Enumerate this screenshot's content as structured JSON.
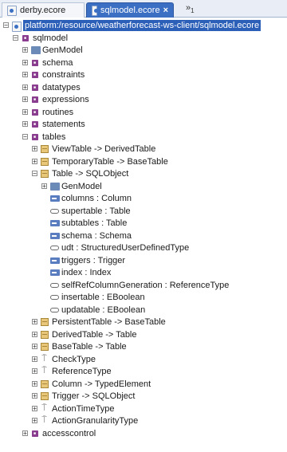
{
  "tabs": [
    {
      "label": "derby.ecore",
      "icon": "ecore-file-icon",
      "active": false
    },
    {
      "label": "sqlmodel.ecore",
      "icon": "ecore-file-icon",
      "active": true
    }
  ],
  "tab_close": "×",
  "tab_overflow": {
    "symbol": "»",
    "count": "1"
  },
  "tree": [
    {
      "label": "platform:/resource/weatherforecast-ws-client/sqlmodel.ecore",
      "depth": 0,
      "icon": "resource-icon",
      "expander": "minus",
      "selected": true
    },
    {
      "label": "sqlmodel",
      "depth": 1,
      "icon": "package-icon",
      "expander": "minus"
    },
    {
      "label": "GenModel",
      "depth": 2,
      "icon": "annotation-icon",
      "expander": "plus"
    },
    {
      "label": "schema",
      "depth": 2,
      "icon": "package-icon",
      "expander": "plus"
    },
    {
      "label": "constraints",
      "depth": 2,
      "icon": "package-icon",
      "expander": "plus"
    },
    {
      "label": "datatypes",
      "depth": 2,
      "icon": "package-icon",
      "expander": "plus"
    },
    {
      "label": "expressions",
      "depth": 2,
      "icon": "package-icon",
      "expander": "plus"
    },
    {
      "label": "routines",
      "depth": 2,
      "icon": "package-icon",
      "expander": "plus"
    },
    {
      "label": "statements",
      "depth": 2,
      "icon": "package-icon",
      "expander": "plus"
    },
    {
      "label": "tables",
      "depth": 2,
      "icon": "package-icon",
      "expander": "minus"
    },
    {
      "label": "ViewTable -> DerivedTable",
      "depth": 3,
      "icon": "class-icon",
      "expander": "plus"
    },
    {
      "label": "TemporaryTable -> BaseTable",
      "depth": 3,
      "icon": "class-icon",
      "expander": "plus"
    },
    {
      "label": "Table -> SQLObject",
      "depth": 3,
      "icon": "class-icon",
      "expander": "minus"
    },
    {
      "label": "GenModel",
      "depth": 4,
      "icon": "annotation-icon",
      "expander": "plus"
    },
    {
      "label": "columns : Column",
      "depth": 4,
      "icon": "reference-icon",
      "expander": ""
    },
    {
      "label": "supertable : Table",
      "depth": 4,
      "icon": "attribute-icon",
      "expander": ""
    },
    {
      "label": "subtables : Table",
      "depth": 4,
      "icon": "reference-icon",
      "expander": ""
    },
    {
      "label": "schema : Schema",
      "depth": 4,
      "icon": "bidirectional-icon",
      "expander": ""
    },
    {
      "label": "udt : StructuredUserDefinedType",
      "depth": 4,
      "icon": "attribute-icon",
      "expander": ""
    },
    {
      "label": "triggers : Trigger",
      "depth": 4,
      "icon": "reference-icon",
      "expander": ""
    },
    {
      "label": "index : Index",
      "depth": 4,
      "icon": "reference-icon",
      "expander": ""
    },
    {
      "label": "selfRefColumnGeneration : ReferenceType",
      "depth": 4,
      "icon": "attribute-icon",
      "expander": ""
    },
    {
      "label": "insertable : EBoolean",
      "depth": 4,
      "icon": "attribute-icon",
      "expander": ""
    },
    {
      "label": "updatable : EBoolean",
      "depth": 4,
      "icon": "attribute-icon",
      "expander": ""
    },
    {
      "label": "PersistentTable -> BaseTable",
      "depth": 3,
      "icon": "class-icon",
      "expander": "plus"
    },
    {
      "label": "DerivedTable -> Table",
      "depth": 3,
      "icon": "class-icon",
      "expander": "plus"
    },
    {
      "label": "BaseTable -> Table",
      "depth": 3,
      "icon": "class-icon",
      "expander": "plus"
    },
    {
      "label": "CheckType",
      "depth": 3,
      "icon": "enum-icon",
      "expander": "plus"
    },
    {
      "label": "ReferenceType",
      "depth": 3,
      "icon": "enum-icon",
      "expander": "plus"
    },
    {
      "label": "Column -> TypedElement",
      "depth": 3,
      "icon": "class-icon",
      "expander": "plus"
    },
    {
      "label": "Trigger -> SQLObject",
      "depth": 3,
      "icon": "class-icon",
      "expander": "plus"
    },
    {
      "label": "ActionTimeType",
      "depth": 3,
      "icon": "enum-icon",
      "expander": "plus"
    },
    {
      "label": "ActionGranularityType",
      "depth": 3,
      "icon": "enum-icon",
      "expander": "plus"
    },
    {
      "label": "accesscontrol",
      "depth": 2,
      "icon": "package-icon",
      "expander": "plus"
    }
  ]
}
